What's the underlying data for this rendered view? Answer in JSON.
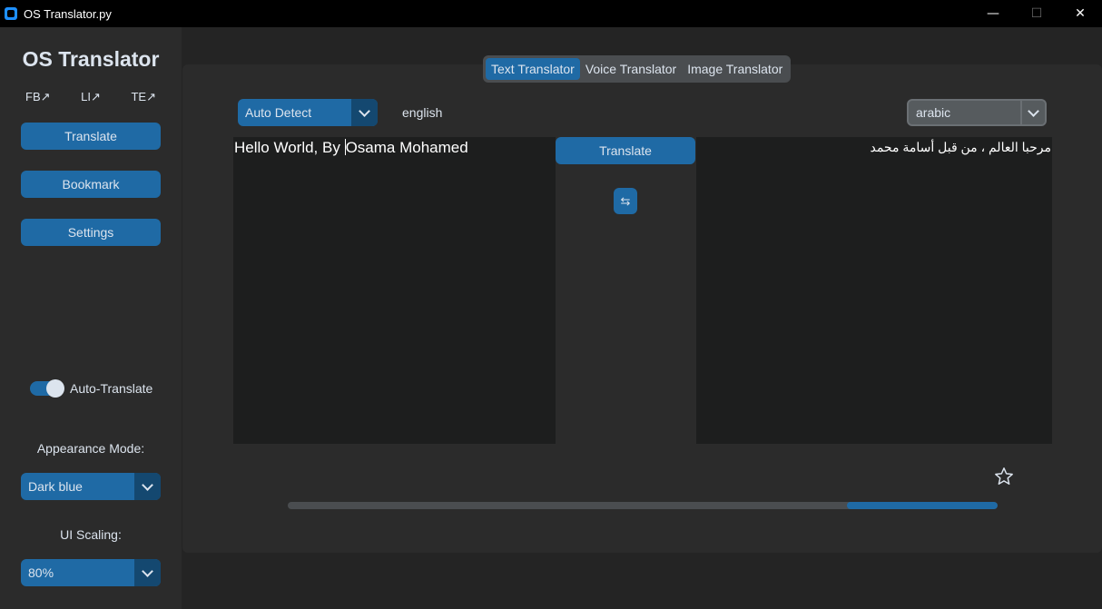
{
  "window": {
    "title": "OS Translator.py",
    "controls": {
      "minimize": "—",
      "maximize": "☐",
      "close": "✕"
    }
  },
  "sidebar": {
    "title": "OS Translator",
    "social_links": [
      "FB↗",
      "LI↗",
      "TE↗"
    ],
    "buttons": {
      "translate": "Translate",
      "bookmark": "Bookmark",
      "settings": "Settings"
    },
    "auto_translate": {
      "label": "Auto-Translate",
      "on": true
    },
    "appearance": {
      "label": "Appearance Mode:",
      "value": "Dark blue"
    },
    "scaling": {
      "label": "UI Scaling:",
      "value": "80%"
    }
  },
  "main": {
    "tabs": [
      {
        "label": "Text Translator",
        "active": true
      },
      {
        "label": "Voice Translator",
        "active": false
      },
      {
        "label": "Image Translator",
        "active": false
      }
    ],
    "source_language": "Auto Detect",
    "detected_language": "english",
    "target_language": "arabic",
    "source_text_before_caret": "Hello World, By ",
    "source_text_after_caret": "Osama Mohamed",
    "translated_text": "مرحبا العالم ، من قبل أسامة محمد",
    "translate_button": "Translate",
    "swap_icon": "⇆",
    "bookmark_icon": "star-outline",
    "progress": {
      "start": 0.788,
      "end": 1.0
    }
  },
  "colors": {
    "accent": "#1f6aa5",
    "accent_dark": "#144870",
    "background": "#242424",
    "panel": "#2b2b2b",
    "textbox": "#1d1e1e"
  }
}
